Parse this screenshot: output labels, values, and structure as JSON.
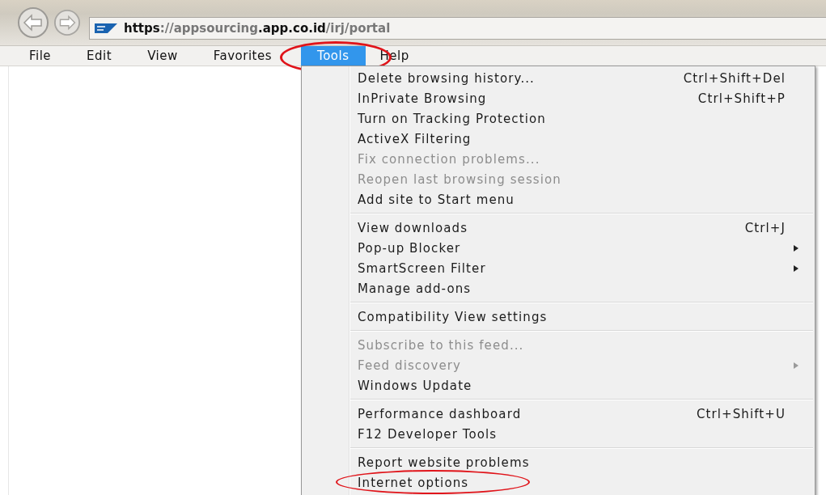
{
  "toolbar": {
    "address": {
      "parts": [
        {
          "text": "https",
          "dim": false
        },
        {
          "text": "://appsourcing",
          "dim": true
        },
        {
          "text": ".app.co.id",
          "dim": false
        },
        {
          "text": "/irj/portal",
          "dim": true
        }
      ]
    }
  },
  "menubar": [
    {
      "label": "File",
      "selected": false,
      "circled": false
    },
    {
      "label": "Edit",
      "selected": false,
      "circled": false
    },
    {
      "label": "View",
      "selected": false,
      "circled": false
    },
    {
      "label": "Favorites",
      "selected": false,
      "circled": false
    },
    {
      "label": "Tools",
      "selected": true,
      "circled": true
    },
    {
      "label": "Help",
      "selected": false,
      "circled": false
    }
  ],
  "menu": {
    "groups": [
      {
        "items": [
          {
            "label": "Delete browsing history...",
            "shortcut": "Ctrl+Shift+Del",
            "disabled": false,
            "submenu": false,
            "circled": false
          },
          {
            "label": "InPrivate Browsing",
            "shortcut": "Ctrl+Shift+P",
            "disabled": false,
            "submenu": false,
            "circled": false
          },
          {
            "label": "Turn on Tracking Protection",
            "disabled": false,
            "submenu": false,
            "circled": false
          },
          {
            "label": "ActiveX Filtering",
            "disabled": false,
            "submenu": false,
            "circled": false
          },
          {
            "label": "Fix connection problems...",
            "disabled": true,
            "submenu": false,
            "circled": false
          },
          {
            "label": "Reopen last browsing session",
            "disabled": true,
            "submenu": false,
            "circled": false
          },
          {
            "label": "Add site to Start menu",
            "disabled": false,
            "submenu": false,
            "circled": false
          }
        ]
      },
      {
        "items": [
          {
            "label": "View downloads",
            "shortcut": "Ctrl+J",
            "disabled": false,
            "submenu": false,
            "circled": false
          },
          {
            "label": "Pop-up Blocker",
            "disabled": false,
            "submenu": true,
            "circled": false
          },
          {
            "label": "SmartScreen Filter",
            "disabled": false,
            "submenu": true,
            "circled": false
          },
          {
            "label": "Manage add-ons",
            "disabled": false,
            "submenu": false,
            "circled": false
          }
        ]
      },
      {
        "items": [
          {
            "label": "Compatibility View settings",
            "disabled": false,
            "submenu": false,
            "circled": false
          }
        ]
      },
      {
        "items": [
          {
            "label": "Subscribe to this feed...",
            "disabled": true,
            "submenu": false,
            "circled": false
          },
          {
            "label": "Feed discovery",
            "disabled": true,
            "submenu": true,
            "circled": false
          },
          {
            "label": "Windows Update",
            "disabled": false,
            "submenu": false,
            "circled": false
          }
        ]
      },
      {
        "items": [
          {
            "label": "Performance dashboard",
            "shortcut": "Ctrl+Shift+U",
            "disabled": false,
            "submenu": false,
            "circled": false
          },
          {
            "label": "F12 Developer Tools",
            "disabled": false,
            "submenu": false,
            "circled": false
          }
        ]
      },
      {
        "items": [
          {
            "label": "Report website problems",
            "disabled": false,
            "submenu": false,
            "circled": false
          },
          {
            "label": "Internet options",
            "disabled": false,
            "submenu": false,
            "circled": true
          }
        ]
      }
    ]
  }
}
